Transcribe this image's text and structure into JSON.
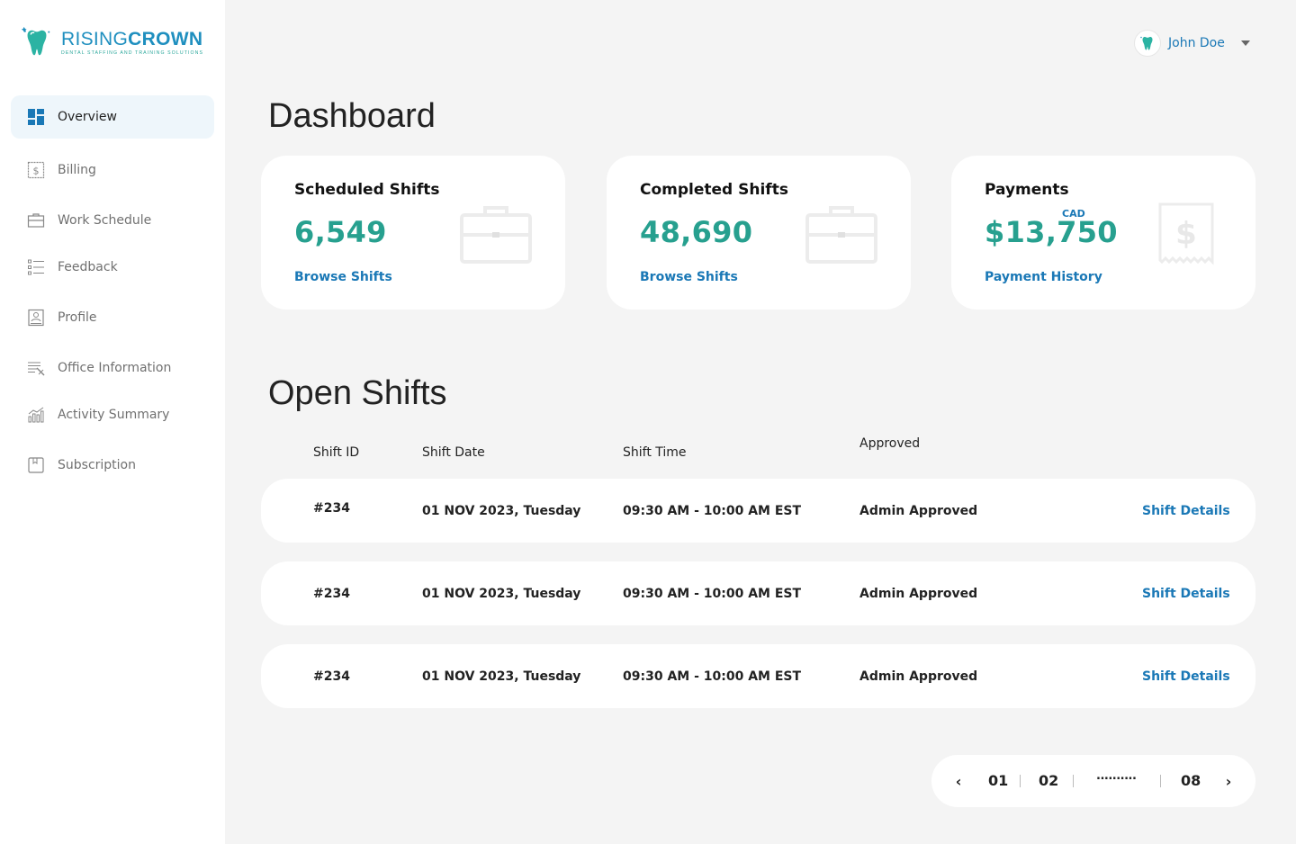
{
  "brand": {
    "name_part1": "RISING",
    "name_part2": "CROWN",
    "tagline": "DENTAL STAFFING AND TRAINING SOLUTIONS"
  },
  "sidebar": {
    "items": [
      {
        "label": "Overview",
        "icon": "dashboard-icon",
        "active": true
      },
      {
        "label": "Billing",
        "icon": "dollar-icon"
      },
      {
        "label": "Work Schedule",
        "icon": "briefcase-icon"
      },
      {
        "label": "Feedback",
        "icon": "checklist-icon"
      },
      {
        "label": "Profile",
        "icon": "profile-icon"
      },
      {
        "label": "Office Information",
        "icon": "office-info-icon"
      },
      {
        "label": "Activity Summary",
        "icon": "chart-icon"
      },
      {
        "label": "Subscription",
        "icon": "subscription-icon"
      }
    ]
  },
  "header": {
    "user_name": "John Doe"
  },
  "dashboard": {
    "title": "Dashboard",
    "cards": [
      {
        "title": "Scheduled Shifts",
        "value": "6,549",
        "link": "Browse Shifts",
        "icon": "briefcase-icon"
      },
      {
        "title": "Completed Shifts",
        "value": "48,690",
        "link": "Browse Shifts",
        "icon": "briefcase-icon"
      },
      {
        "title": "Payments",
        "value": "$13,750",
        "currency": "CAD",
        "link": "Payment History",
        "icon": "receipt-dollar-icon"
      }
    ]
  },
  "open_shifts": {
    "title": "Open Shifts",
    "columns": [
      "Shift ID",
      "Shift Date",
      "Shift Time",
      "Approved"
    ],
    "rows": [
      {
        "id": "#234",
        "date": "01 NOV 2023, Tuesday",
        "time": "09:30 AM - 10:00 AM EST",
        "approved": "Admin Approved",
        "action": "Shift Details"
      },
      {
        "id": "#234",
        "date": "01 NOV 2023, Tuesday",
        "time": "09:30 AM - 10:00 AM EST",
        "approved": "Admin Approved",
        "action": "Shift Details"
      },
      {
        "id": "#234",
        "date": "01 NOV 2023, Tuesday",
        "time": "09:30 AM - 10:00 AM EST",
        "approved": "Admin Approved",
        "action": "Shift Details"
      }
    ]
  },
  "pagination": {
    "prev": "‹",
    "next": "›",
    "pages": [
      "01",
      "02",
      "..........",
      "08"
    ]
  },
  "colors": {
    "accent_blue": "#1a78b6",
    "accent_teal": "#27a08f",
    "background": "#f4f4f4"
  }
}
